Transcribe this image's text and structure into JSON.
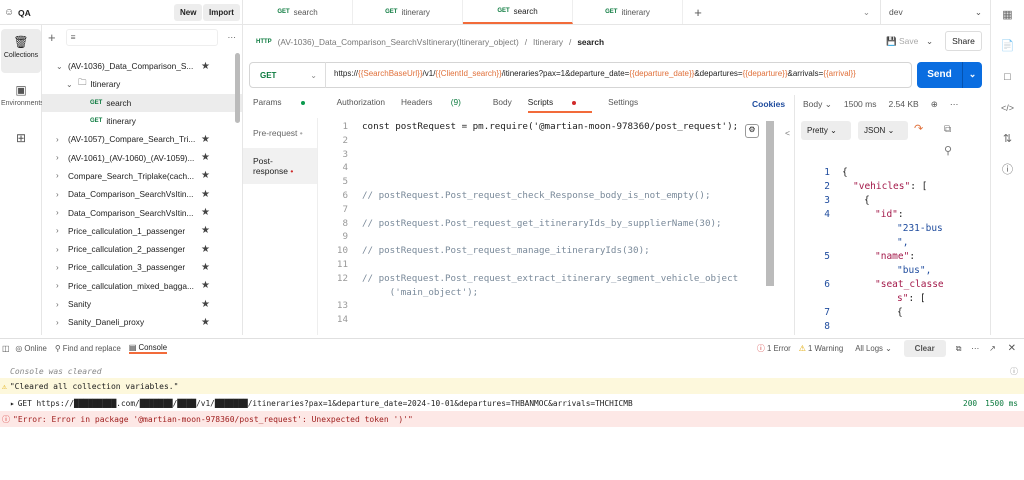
{
  "workspace": {
    "name": "QA",
    "new_label": "New",
    "import_label": "Import"
  },
  "rail": [
    {
      "label": "Collections",
      "icon": "trash-icon"
    },
    {
      "label": "Environments",
      "icon": "environment-icon"
    },
    {
      "label": "",
      "icon": "apps-icon"
    }
  ],
  "tree": {
    "root": "(AV-1036)_Data_Comparison_S...",
    "folder": "Itinerary",
    "requests": [
      {
        "method": "GET",
        "name": "search"
      },
      {
        "method": "GET",
        "name": "itinerary"
      }
    ],
    "collections": [
      "(AV-1057)_Compare_Search_Tri...",
      "(AV-1061)_(AV-1060)_(AV-1059)...",
      "Compare_Search_Triplake(cach...",
      "Data_Comparison_SearchVsItin...",
      "Data_Comparison_SearchVsItin...",
      "Price_callculation_1_passenger",
      "Price_callculation_2_passenger",
      "Price_callculation_3_passenger",
      "Price_callculation_mixed_bagga...",
      "Sanity",
      "Sanity_Daneli_proxy"
    ]
  },
  "tabs": [
    {
      "method": "GET",
      "name": "search"
    },
    {
      "method": "GET",
      "name": "itinerary"
    },
    {
      "method": "GET",
      "name": "search"
    },
    {
      "method": "GET",
      "name": "itinerary"
    }
  ],
  "environment": "dev",
  "breadcrumb": {
    "icon": "HTTP",
    "parts": [
      "(AV-1036)_Data_Comparison_SearchVsItinerary(Itinerary_object)",
      "Itinerary",
      "search"
    ]
  },
  "actions": {
    "save": "Save",
    "share": "Share"
  },
  "request": {
    "method": "GET",
    "url": {
      "p1": "https://",
      "v1": "{{SearchBaseUrl}}",
      "p2": "/v1/",
      "v2": "{{ClientId_search}}",
      "p3": "/itineraries?pax=1&departure_date=",
      "v3": "{{departure_date}}",
      "p4": "&departures=",
      "v4": "{{departure}}",
      "p5": "&arrivals=",
      "v5": "{{arrival}}"
    },
    "send": "Send"
  },
  "subtabs": {
    "params": "Params",
    "authorization": "Authorization",
    "headers": "Headers",
    "headers_count": "(9)",
    "body": "Body",
    "scripts": "Scripts",
    "settings": "Settings",
    "cookies": "Cookies"
  },
  "script_nav": {
    "pre": "Pre-request",
    "post": "Post-response"
  },
  "code": [
    {
      "n": "1",
      "t": "const postRequest = pm.require('@martian-moon-978360/post_request');",
      "c": false
    },
    {
      "n": "2",
      "t": "",
      "c": false
    },
    {
      "n": "3",
      "t": "",
      "c": false
    },
    {
      "n": "4",
      "t": "",
      "c": false
    },
    {
      "n": "5",
      "t": "",
      "c": false
    },
    {
      "n": "6",
      "t": "// postRequest.Post_request_check_Response_body_is_not_empty();",
      "c": true
    },
    {
      "n": "7",
      "t": "",
      "c": false
    },
    {
      "n": "8",
      "t": "// postRequest.Post_request_get_itineraryIds_by_supplierName(30);",
      "c": true
    },
    {
      "n": "9",
      "t": "",
      "c": false
    },
    {
      "n": "10",
      "t": "// postRequest.Post_request_manage_itineraryIds(30);",
      "c": true
    },
    {
      "n": "11",
      "t": "",
      "c": false
    },
    {
      "n": "12",
      "t": "// postRequest.Post_request_extract_itinerary_segment_vehicle_object",
      "c": true
    },
    {
      "n": "",
      "t": "     ('main_object');",
      "c": true
    },
    {
      "n": "13",
      "t": "",
      "c": false
    },
    {
      "n": "14",
      "t": "",
      "c": false
    }
  ],
  "response": {
    "body_label": "Body",
    "time": "1500 ms",
    "size": "2.54 KB",
    "format": "Pretty",
    "lang": "JSON",
    "lines": [
      {
        "n": "1",
        "t": "{"
      },
      {
        "n": "2",
        "k": "\"vehicles\"",
        "t": ": ["
      },
      {
        "n": "3",
        "t": "{"
      },
      {
        "n": "4",
        "k": "\"id\"",
        "t": ":"
      },
      {
        "n": "",
        "s": "\"231-bus"
      },
      {
        "n": "",
        "s": "\","
      },
      {
        "n": "5",
        "k": "\"name\"",
        "t": ":"
      },
      {
        "n": "",
        "s": "\"bus\","
      },
      {
        "n": "6",
        "k": "\"seat_classe"
      },
      {
        "n": "",
        "k": "s\"",
        "t": ": ["
      },
      {
        "n": "7",
        "t": "{"
      },
      {
        "n": "8",
        "t": ""
      }
    ]
  },
  "console": {
    "online": "Online",
    "find": "Find and replace",
    "console": "Console",
    "errors": "1 Error",
    "warnings": "1 Warning",
    "all_logs": "All Logs",
    "clear": "Clear",
    "cleared": "Console was cleared",
    "warning_msg": "\"Cleared all collection variables.\"",
    "request_line": "GET https://█████████.com/███████/████/v1/███████/itineraries?pax=1&departure_date=2024-10-01&departures=THBANMOC&arrivals=THCHICMB",
    "status": "200",
    "duration": "1500 ms",
    "error_msg": "\"Error: Error in package '@martian-moon-978360/post_request': Unexpected token ')'\""
  }
}
